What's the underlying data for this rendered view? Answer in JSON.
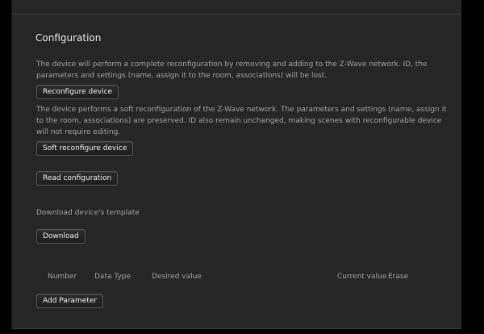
{
  "config": {
    "title": "Configuration",
    "reconfigure_description": "The device will perform a complete reconfiguration by removing and adding to the Z-Wave network. ID, the parameters and settings (name, assign it to the room, associations) will be lost.",
    "reconfigure_button": "Reconfigure device",
    "soft_description": "The device performs a soft reconfiguration of the Z-Wave network. The parameters and settings (name, assign it to the room, associations) are preserved. ID also remain unchanged, making scenes with reconfigurable device will not require editing.",
    "soft_button": "Soft reconfigure device",
    "read_button": "Read configuration",
    "template_label": "Download device's template",
    "download_button": "Download",
    "table": {
      "headers": {
        "number": "Number",
        "data_type": "Data Type",
        "desired_value": "Desired value",
        "current_value": "Current value",
        "erase": "Erase"
      }
    },
    "add_parameter_button": "Add Parameter"
  },
  "colors": {
    "panel_bg": "#262626",
    "page_bg": "#000000",
    "text_muted": "#a3a3a3",
    "text_title": "#e8e8e8"
  }
}
